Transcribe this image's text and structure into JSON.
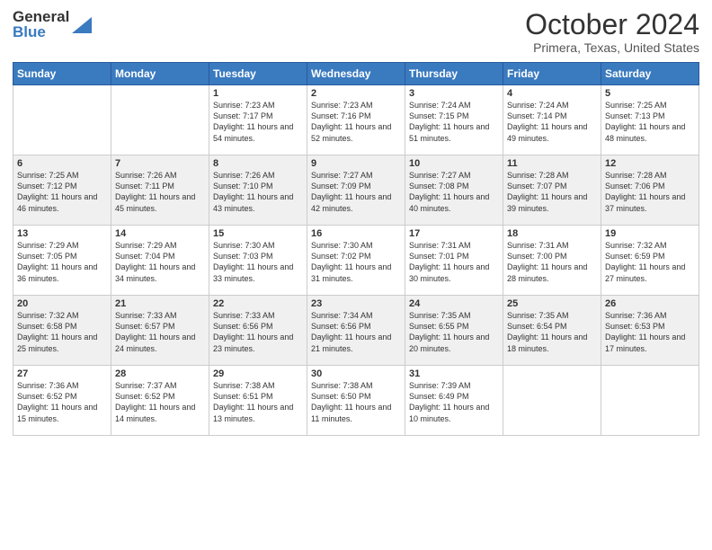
{
  "logo": {
    "text_general": "General",
    "text_blue": "Blue"
  },
  "title": "October 2024",
  "subtitle": "Primera, Texas, United States",
  "days_header": [
    "Sunday",
    "Monday",
    "Tuesday",
    "Wednesday",
    "Thursday",
    "Friday",
    "Saturday"
  ],
  "weeks": [
    [
      {
        "day": "",
        "info": ""
      },
      {
        "day": "",
        "info": ""
      },
      {
        "day": "1",
        "info": "Sunrise: 7:23 AM\nSunset: 7:17 PM\nDaylight: 11 hours and 54 minutes."
      },
      {
        "day": "2",
        "info": "Sunrise: 7:23 AM\nSunset: 7:16 PM\nDaylight: 11 hours and 52 minutes."
      },
      {
        "day": "3",
        "info": "Sunrise: 7:24 AM\nSunset: 7:15 PM\nDaylight: 11 hours and 51 minutes."
      },
      {
        "day": "4",
        "info": "Sunrise: 7:24 AM\nSunset: 7:14 PM\nDaylight: 11 hours and 49 minutes."
      },
      {
        "day": "5",
        "info": "Sunrise: 7:25 AM\nSunset: 7:13 PM\nDaylight: 11 hours and 48 minutes."
      }
    ],
    [
      {
        "day": "6",
        "info": "Sunrise: 7:25 AM\nSunset: 7:12 PM\nDaylight: 11 hours and 46 minutes."
      },
      {
        "day": "7",
        "info": "Sunrise: 7:26 AM\nSunset: 7:11 PM\nDaylight: 11 hours and 45 minutes."
      },
      {
        "day": "8",
        "info": "Sunrise: 7:26 AM\nSunset: 7:10 PM\nDaylight: 11 hours and 43 minutes."
      },
      {
        "day": "9",
        "info": "Sunrise: 7:27 AM\nSunset: 7:09 PM\nDaylight: 11 hours and 42 minutes."
      },
      {
        "day": "10",
        "info": "Sunrise: 7:27 AM\nSunset: 7:08 PM\nDaylight: 11 hours and 40 minutes."
      },
      {
        "day": "11",
        "info": "Sunrise: 7:28 AM\nSunset: 7:07 PM\nDaylight: 11 hours and 39 minutes."
      },
      {
        "day": "12",
        "info": "Sunrise: 7:28 AM\nSunset: 7:06 PM\nDaylight: 11 hours and 37 minutes."
      }
    ],
    [
      {
        "day": "13",
        "info": "Sunrise: 7:29 AM\nSunset: 7:05 PM\nDaylight: 11 hours and 36 minutes."
      },
      {
        "day": "14",
        "info": "Sunrise: 7:29 AM\nSunset: 7:04 PM\nDaylight: 11 hours and 34 minutes."
      },
      {
        "day": "15",
        "info": "Sunrise: 7:30 AM\nSunset: 7:03 PM\nDaylight: 11 hours and 33 minutes."
      },
      {
        "day": "16",
        "info": "Sunrise: 7:30 AM\nSunset: 7:02 PM\nDaylight: 11 hours and 31 minutes."
      },
      {
        "day": "17",
        "info": "Sunrise: 7:31 AM\nSunset: 7:01 PM\nDaylight: 11 hours and 30 minutes."
      },
      {
        "day": "18",
        "info": "Sunrise: 7:31 AM\nSunset: 7:00 PM\nDaylight: 11 hours and 28 minutes."
      },
      {
        "day": "19",
        "info": "Sunrise: 7:32 AM\nSunset: 6:59 PM\nDaylight: 11 hours and 27 minutes."
      }
    ],
    [
      {
        "day": "20",
        "info": "Sunrise: 7:32 AM\nSunset: 6:58 PM\nDaylight: 11 hours and 25 minutes."
      },
      {
        "day": "21",
        "info": "Sunrise: 7:33 AM\nSunset: 6:57 PM\nDaylight: 11 hours and 24 minutes."
      },
      {
        "day": "22",
        "info": "Sunrise: 7:33 AM\nSunset: 6:56 PM\nDaylight: 11 hours and 23 minutes."
      },
      {
        "day": "23",
        "info": "Sunrise: 7:34 AM\nSunset: 6:56 PM\nDaylight: 11 hours and 21 minutes."
      },
      {
        "day": "24",
        "info": "Sunrise: 7:35 AM\nSunset: 6:55 PM\nDaylight: 11 hours and 20 minutes."
      },
      {
        "day": "25",
        "info": "Sunrise: 7:35 AM\nSunset: 6:54 PM\nDaylight: 11 hours and 18 minutes."
      },
      {
        "day": "26",
        "info": "Sunrise: 7:36 AM\nSunset: 6:53 PM\nDaylight: 11 hours and 17 minutes."
      }
    ],
    [
      {
        "day": "27",
        "info": "Sunrise: 7:36 AM\nSunset: 6:52 PM\nDaylight: 11 hours and 15 minutes."
      },
      {
        "day": "28",
        "info": "Sunrise: 7:37 AM\nSunset: 6:52 PM\nDaylight: 11 hours and 14 minutes."
      },
      {
        "day": "29",
        "info": "Sunrise: 7:38 AM\nSunset: 6:51 PM\nDaylight: 11 hours and 13 minutes."
      },
      {
        "day": "30",
        "info": "Sunrise: 7:38 AM\nSunset: 6:50 PM\nDaylight: 11 hours and 11 minutes."
      },
      {
        "day": "31",
        "info": "Sunrise: 7:39 AM\nSunset: 6:49 PM\nDaylight: 11 hours and 10 minutes."
      },
      {
        "day": "",
        "info": ""
      },
      {
        "day": "",
        "info": ""
      }
    ]
  ]
}
